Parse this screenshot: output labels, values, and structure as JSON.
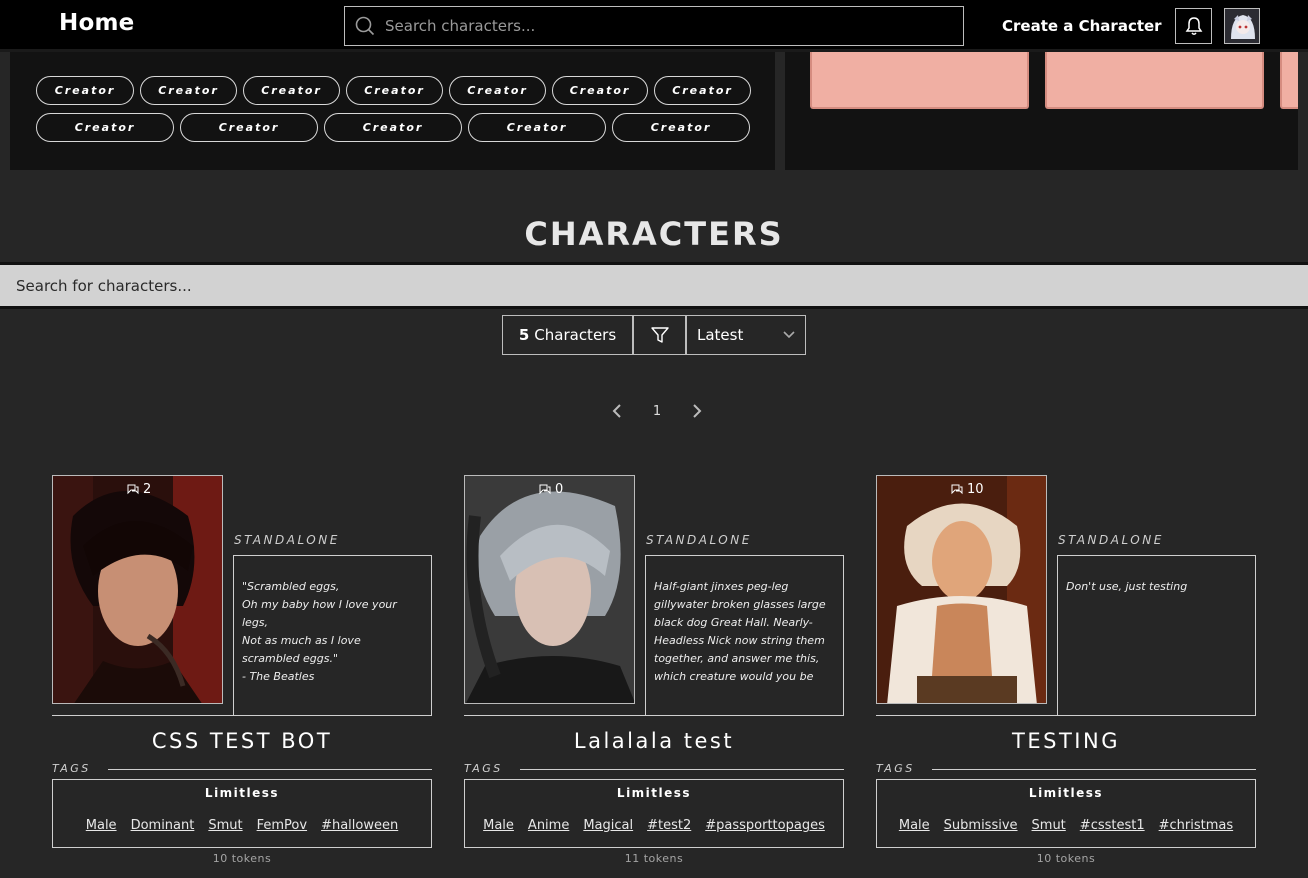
{
  "topbar": {
    "home": "Home",
    "search_placeholder": "Search characters...",
    "create": "Create a Character",
    "bell_icon": "bell-icon",
    "avatar_icon": "user-avatar"
  },
  "creators": {
    "row1": [
      "Creator",
      "Creator",
      "Creator",
      "Creator",
      "Creator",
      "Creator",
      "Creator"
    ],
    "row2": [
      "Creator",
      "Creator",
      "Creator",
      "Creator",
      "Creator"
    ]
  },
  "section": {
    "title": "CHARACTERS",
    "search_placeholder": "Search for characters...",
    "count_number": "5",
    "count_label": "Characters",
    "filter_icon": "filter-icon",
    "sort_value": "Latest",
    "page": "1"
  },
  "cards": [
    {
      "chat_count": "2",
      "kind": "STANDALONE",
      "description": "\"Scrambled eggs,\nOh my baby how I love your legs,\nNot as much as I love scrambled eggs.\"\n- The Beatles",
      "name": "CSS TEST BOT",
      "tags_label": "TAGS",
      "limitless": "Limitless",
      "tags": [
        " Male",
        " Dominant",
        " Smut",
        " FemPov",
        "#halloween"
      ],
      "tokens": "10 tokens"
    },
    {
      "chat_count": "0",
      "kind": "STANDALONE",
      "description": "Half-giant jinxes peg-leg gillywater broken glasses large black dog Great Hall. Nearly-Headless Nick now string them together, and answer me this, which creature would you be",
      "name": "Lalalala test",
      "tags_label": "TAGS",
      "limitless": "Limitless",
      "tags": [
        " Male",
        " Anime",
        " Magical",
        "#test2",
        "#passporttopages"
      ],
      "tokens": "11 tokens"
    },
    {
      "chat_count": "10",
      "kind": "STANDALONE",
      "description": "Don't use, just testing",
      "name": "TESTING",
      "tags_label": "TAGS",
      "limitless": "Limitless",
      "tags": [
        " Male",
        " Submissive",
        " Smut",
        "#csstest1",
        "#christmas"
      ],
      "tokens": "10 tokens"
    }
  ]
}
